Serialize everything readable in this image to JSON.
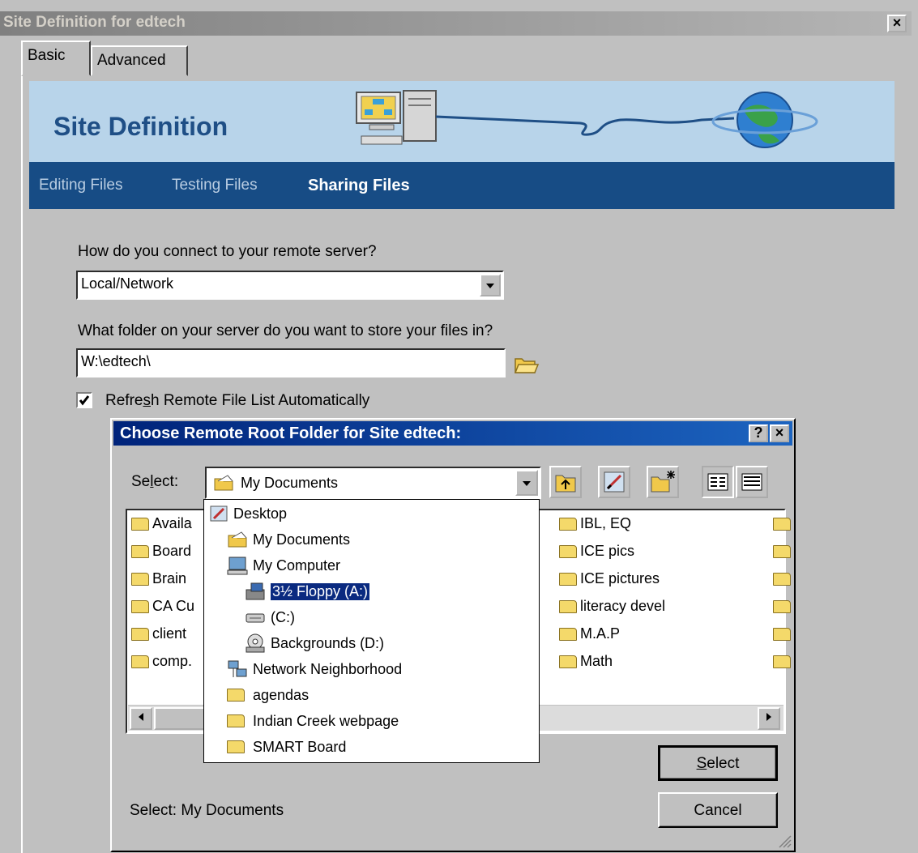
{
  "window": {
    "title": "Site Definition for edtech",
    "close_label": "×"
  },
  "tabs": [
    "Basic",
    "Advanced"
  ],
  "banner": {
    "title": "Site Definition"
  },
  "nav": {
    "editing": "Editing Files",
    "testing": "Testing Files",
    "sharing": "Sharing Files"
  },
  "form": {
    "connect_question": "How do you connect to your remote server?",
    "connect_value": "Local/Network",
    "folder_question": "What folder on your server do you want to store your files in?",
    "folder_value": "W:\\edtech\\",
    "refresh_label_pre": "Refre",
    "refresh_label_u": "s",
    "refresh_label_post": "h Remote File List Automatically",
    "refresh_checked": true
  },
  "dialog": {
    "title": "Choose Remote Root Folder for Site edtech:",
    "help_label": "?",
    "close_label": "×",
    "select_label_pre": "Se",
    "select_label_u": "l",
    "select_label_post": "ect:",
    "select_value": "My Documents",
    "files_left": [
      "Availa",
      "Board",
      "Brain",
      "CA Cu",
      "client",
      "comp."
    ],
    "files_right": [
      "IBL, EQ",
      "ICE pics",
      "ICE pictures",
      "literacy devel",
      "M.A.P",
      "Math"
    ],
    "dropdown_items": [
      {
        "label": "Desktop",
        "icon": "desktop-icon"
      },
      {
        "label": "My Documents",
        "icon": "my-documents-icon"
      },
      {
        "label": "My Computer",
        "icon": "my-computer-icon"
      },
      {
        "label": "3½ Floppy (A:)",
        "icon": "floppy-icon"
      },
      {
        "label": "(C:)",
        "icon": "hard-drive-icon"
      },
      {
        "label": "Backgrounds (D:)",
        "icon": "cd-drive-icon"
      },
      {
        "label": "Network Neighborhood",
        "icon": "network-icon"
      },
      {
        "label": "agendas",
        "icon": "folder-icon"
      },
      {
        "label": "Indian Creek webpage",
        "icon": "folder-icon"
      },
      {
        "label": "SMART Board",
        "icon": "folder-icon"
      }
    ],
    "select_button_u": "S",
    "select_button_rest": "elect",
    "cancel_button": "Cancel",
    "status": "Select: My Documents"
  }
}
